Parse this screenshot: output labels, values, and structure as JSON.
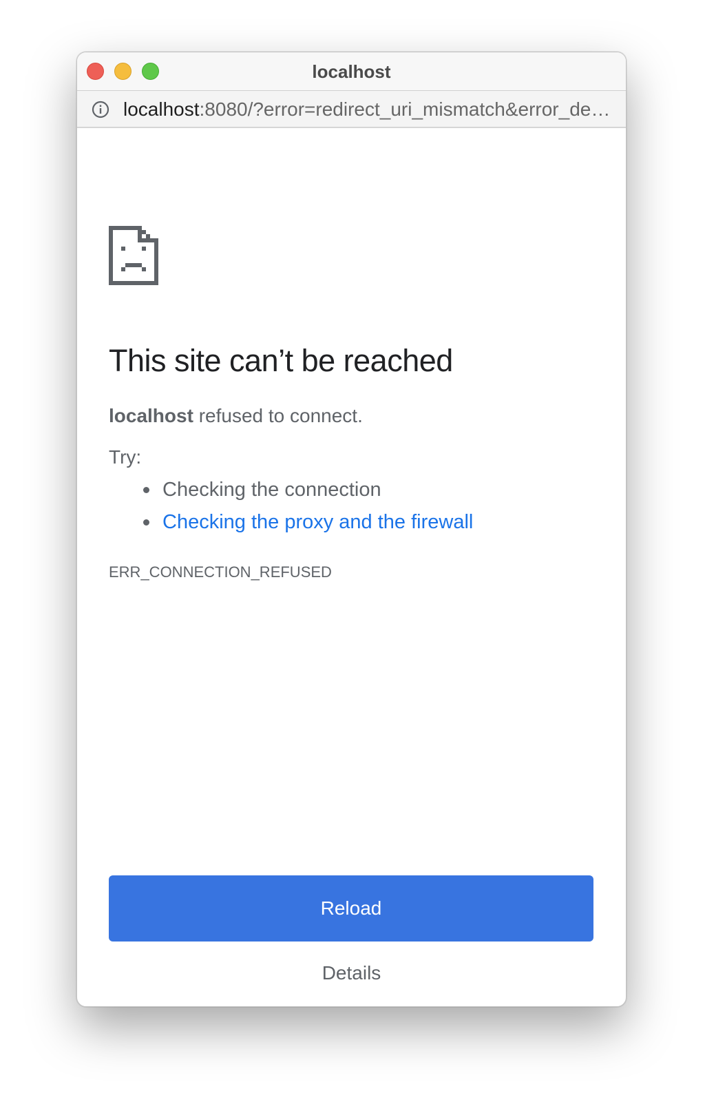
{
  "window": {
    "title": "localhost"
  },
  "address_bar": {
    "icon": "info-icon",
    "host": "localhost",
    "rest": ":8080/?error=redirect_uri_mismatch&error_description=..."
  },
  "error_page": {
    "icon": "sad-page-icon",
    "heading": "This site can’t be reached",
    "host": "localhost",
    "message_rest": " refused to connect.",
    "try_label": "Try:",
    "suggestions": [
      {
        "label": "Checking the connection",
        "is_link": false
      },
      {
        "label": "Checking the proxy and the firewall",
        "is_link": true
      }
    ],
    "error_code": "ERR_CONNECTION_REFUSED",
    "reload_label": "Reload",
    "details_label": "Details"
  },
  "colors": {
    "link": "#1a73e8",
    "button": "#3874e0",
    "close": "#ee5f57",
    "minimize": "#f5bd3e",
    "zoom": "#5fc84a"
  }
}
